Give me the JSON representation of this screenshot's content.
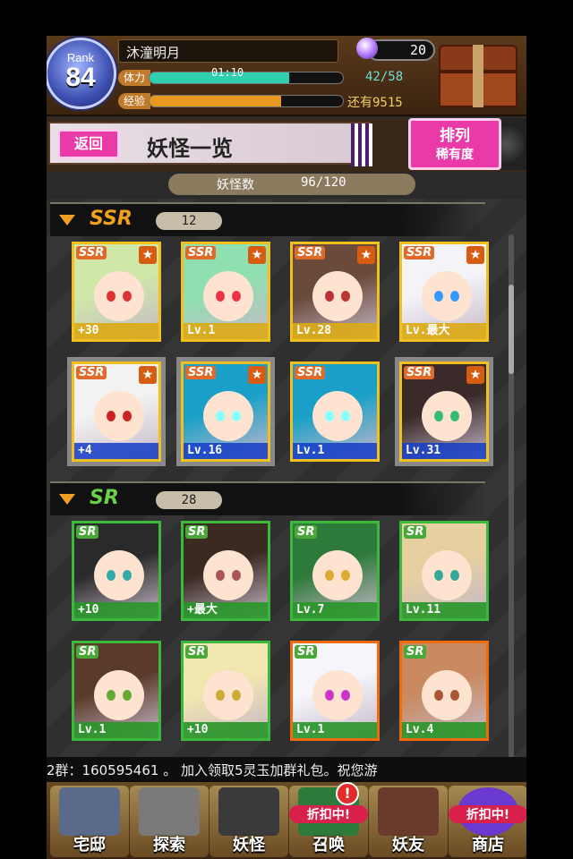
{
  "player": {
    "rank_label": "Rank",
    "rank": "84",
    "name": "沐潼明月",
    "gems": "20",
    "stamina_label": "体力",
    "stamina_timer": "01:10",
    "stamina": "42/58",
    "stamina_fill": 0.72,
    "exp_label": "经验",
    "exp_remaining": "还有9515",
    "exp_fill": 0.68
  },
  "title_bar": {
    "back": "返回",
    "title": "妖怪一览",
    "sort_line1": "排列",
    "sort_line2": "稀有度"
  },
  "count": {
    "label": "妖怪数",
    "value": "96/120"
  },
  "sections": [
    {
      "rarity": "SSR",
      "count": "12",
      "cards": [
        {
          "badge": "SSR",
          "level": "+30",
          "hair": "#cfe8a8",
          "eye": "#d33"
        },
        {
          "badge": "SSR",
          "level": "Lv.1",
          "hair": "#8fe0b0",
          "eye": "#e34"
        },
        {
          "badge": "SSR",
          "level": "Lv.28",
          "hair": "#6a4a3a",
          "eye": "#b33"
        },
        {
          "badge": "SSR",
          "level": "Lv.最大",
          "hair": "#f3f3f8",
          "eye": "#39f"
        },
        {
          "badge": "SSR",
          "level": "+4",
          "hair": "#f2f2f2",
          "eye": "#c22"
        },
        {
          "badge": "SSR",
          "level": "Lv.16",
          "hair": "#1aa0c8",
          "eye": "#8ff"
        },
        {
          "badge": "SSR",
          "level": "Lv.1",
          "hair": "#1aa0c8",
          "eye": "#8ff"
        },
        {
          "badge": "SSR",
          "level": "Lv.31",
          "hair": "#3a2a2a",
          "eye": "#3b7"
        }
      ]
    },
    {
      "rarity": "SR",
      "count": "28",
      "cards": [
        {
          "badge": "SR",
          "level": "+10",
          "hair": "#2a2a2a",
          "eye": "#3aa"
        },
        {
          "badge": "SR",
          "level": "+最大",
          "hair": "#3a2a22",
          "eye": "#a55"
        },
        {
          "badge": "SR",
          "level": "Lv.7",
          "hair": "#2e7a3a",
          "eye": "#da3"
        },
        {
          "badge": "SR",
          "level": "Lv.11",
          "hair": "#e6d0a0",
          "eye": "#3a9"
        },
        {
          "badge": "SR",
          "level": "Lv.1",
          "hair": "#5a3a2a",
          "eye": "#6a3"
        },
        {
          "badge": "SR",
          "level": "+10",
          "hair": "#f2e6b0",
          "eye": "#ca3"
        },
        {
          "badge": "SR",
          "level": "Lv.1",
          "hair": "#f5f5fa",
          "eye": "#c3c"
        },
        {
          "badge": "SR",
          "level": "Lv.4",
          "hair": "#c98a60",
          "eye": "#a53"
        }
      ]
    }
  ],
  "ticker": "2群：160595461 。 加入领取5灵玉加群礼包。祝您游",
  "nav": [
    {
      "label": "宅邸",
      "icon": "mansion-icon",
      "sale": ""
    },
    {
      "label": "探索",
      "icon": "magnifier-icon",
      "sale": ""
    },
    {
      "label": "妖怪",
      "icon": "yokai-card-icon",
      "sale": ""
    },
    {
      "label": "召唤",
      "icon": "summon-icon",
      "sale": "折扣中!",
      "alert": "!"
    },
    {
      "label": "妖友",
      "icon": "friend-icon",
      "sale": ""
    },
    {
      "label": "商店",
      "icon": "shop-orb-icon",
      "sale": "折扣中!"
    }
  ],
  "colors": {
    "accent_pink": "#ea3aa8",
    "ssr_gold": "#f0c020",
    "sr_green": "#3cb83c",
    "stamina_teal": "#2ed0b0",
    "exp_orange": "#e89a20"
  }
}
